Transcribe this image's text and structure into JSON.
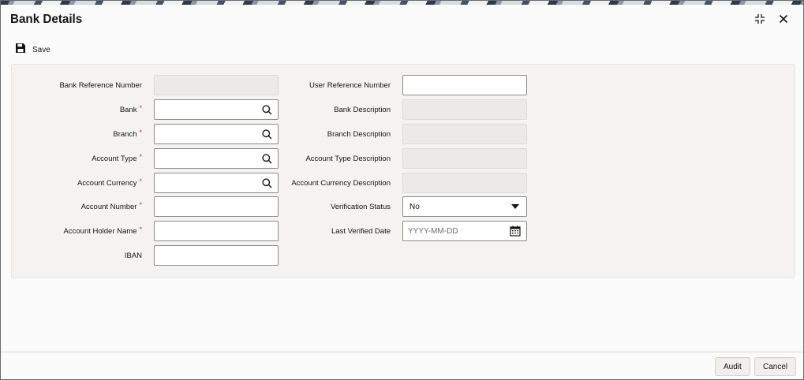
{
  "window": {
    "title": "Bank Details",
    "maximize_icon": "collapse-icon",
    "close_icon": "close-icon"
  },
  "toolbar": {
    "save_label": "Save",
    "save_icon": "floppy-disk-icon"
  },
  "left_fields": {
    "bank_reference_number": {
      "label": "Bank Reference Number",
      "value": ""
    },
    "bank": {
      "label": "Bank",
      "value": ""
    },
    "branch": {
      "label": "Branch",
      "value": ""
    },
    "account_type": {
      "label": "Account Type",
      "value": ""
    },
    "account_currency": {
      "label": "Account Currency",
      "value": ""
    },
    "account_number": {
      "label": "Account Number",
      "value": ""
    },
    "account_holder_name": {
      "label": "Account Holder Name",
      "value": ""
    },
    "iban": {
      "label": "IBAN",
      "value": ""
    }
  },
  "right_fields": {
    "user_reference_number": {
      "label": "User Reference Number",
      "value": ""
    },
    "bank_description": {
      "label": "Bank Description",
      "value": ""
    },
    "branch_description": {
      "label": "Branch Description",
      "value": ""
    },
    "account_type_description": {
      "label": "Account Type Description",
      "value": ""
    },
    "account_currency_description": {
      "label": "Account Currency Description",
      "value": ""
    },
    "verification_status": {
      "label": "Verification Status",
      "value": "No"
    },
    "last_verified_date": {
      "label": "Last Verified Date",
      "placeholder": "YYYY-MM-DD"
    }
  },
  "required_marker": "*",
  "footer": {
    "audit_label": "Audit",
    "cancel_label": "Cancel"
  },
  "colors": {
    "required": "#d0372b",
    "readonly_bg": "#eceae7",
    "panel_bg": "#f4f3f1"
  }
}
